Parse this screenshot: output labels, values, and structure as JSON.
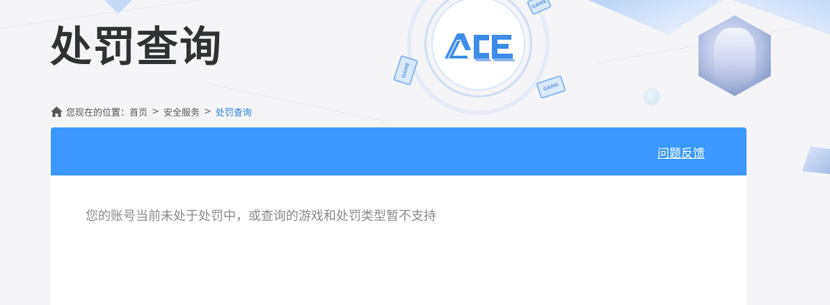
{
  "page_title": "处罚查询",
  "breadcrumb": {
    "prefix": "您现在的位置：",
    "items": [
      "首页",
      "安全服务",
      "处罚查询"
    ],
    "separator": ">"
  },
  "panel": {
    "feedback_label": "问题反馈",
    "message": "您的账号当前未处于处罚中，或查询的游戏和处罚类型暂不支持"
  },
  "decor": {
    "game_card_label": "GAME",
    "logo_icon": "ace-logo-icon"
  },
  "colors": {
    "header_blue": "#3a98ff",
    "link_current": "#2f7fd8",
    "title": "#303133"
  }
}
